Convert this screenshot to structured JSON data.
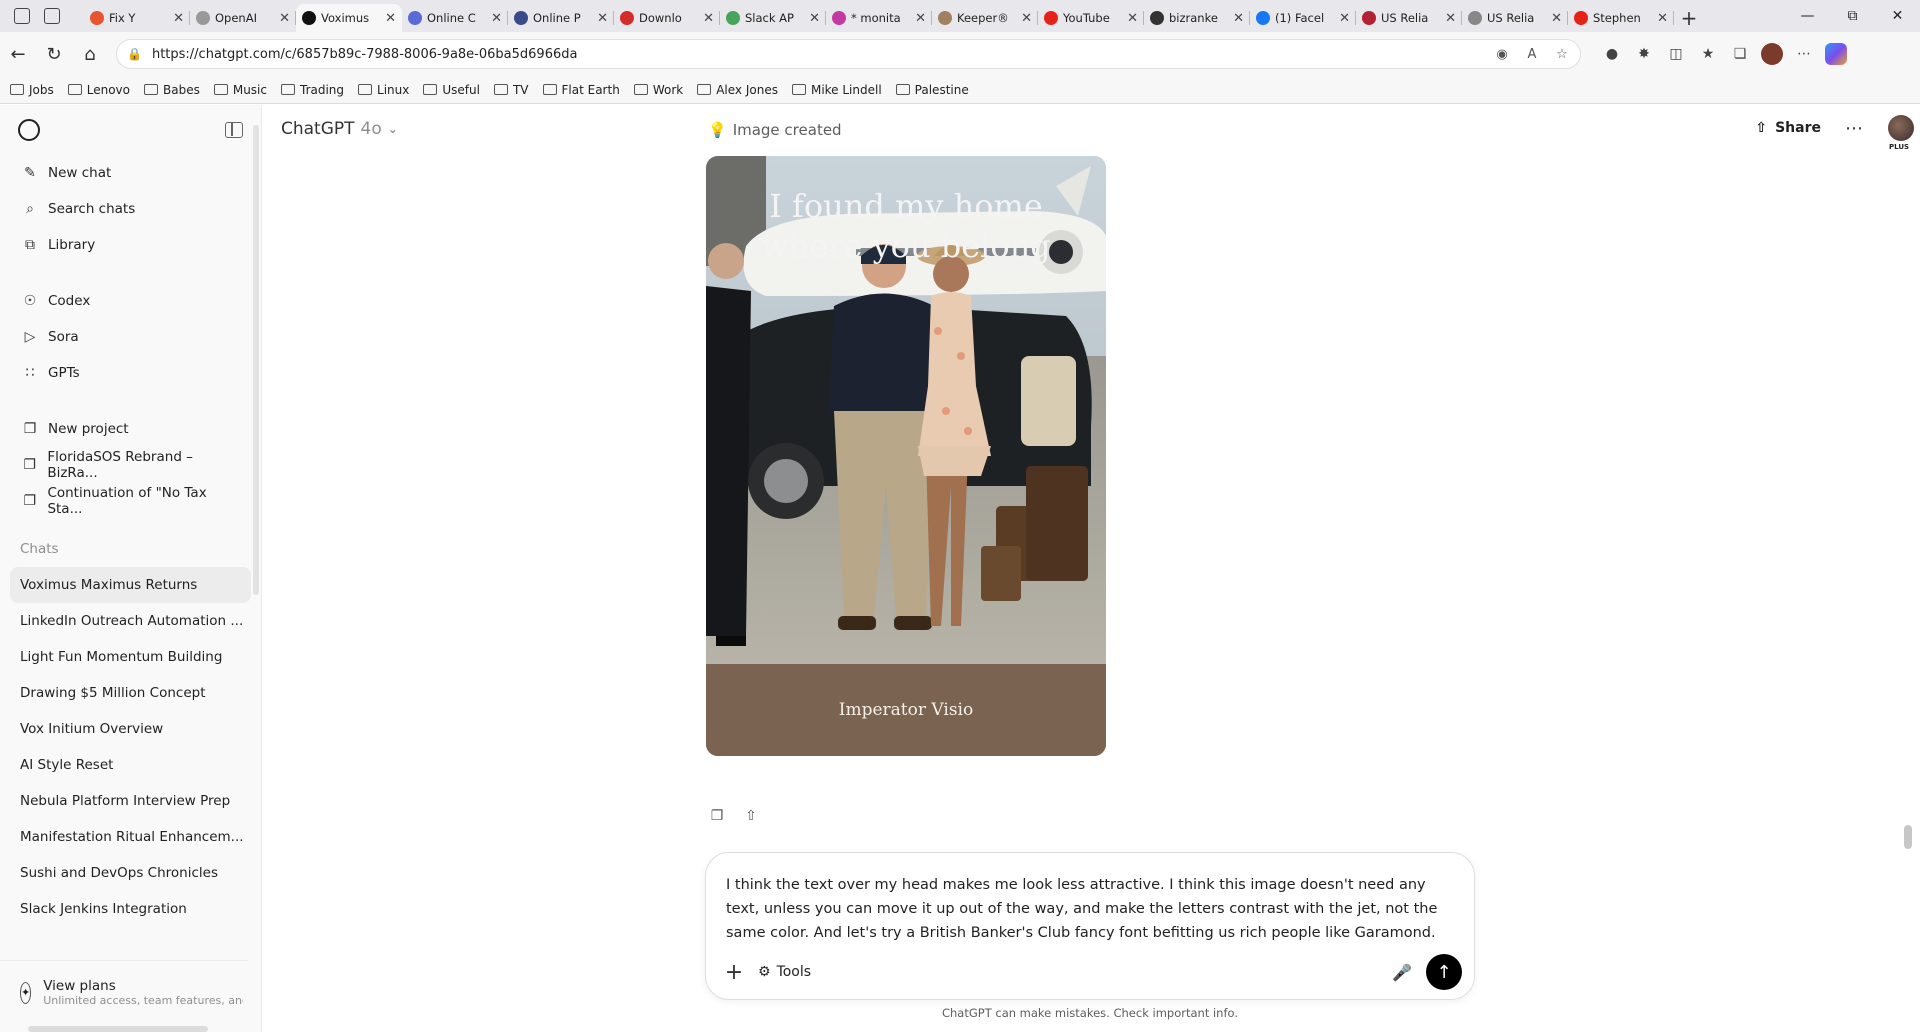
{
  "browser": {
    "tabs": [
      {
        "label": "Fix Y",
        "color": "#e8542f"
      },
      {
        "label": "OpenAI",
        "color": "#999999"
      },
      {
        "label": "Voximus",
        "color": "#111111",
        "active": true
      },
      {
        "label": "Online C",
        "color": "#5a6bd8"
      },
      {
        "label": "Online P",
        "color": "#3a4a8a"
      },
      {
        "label": "Downlo",
        "color": "#d42b2b"
      },
      {
        "label": "Slack AP",
        "color": "#4aa35a"
      },
      {
        "label": "* monita",
        "color": "#c23aa0"
      },
      {
        "label": "Keeper®",
        "color": "#a08060"
      },
      {
        "label": "YouTube",
        "color": "#e62117"
      },
      {
        "label": "bizranke",
        "color": "#333333"
      },
      {
        "label": "(1) Facel",
        "color": "#1877f2"
      },
      {
        "label": "US Relia",
        "color": "#b22234"
      },
      {
        "label": "US Relia",
        "color": "#888888"
      },
      {
        "label": "Stephen",
        "color": "#e62117"
      }
    ],
    "url": "https://chatgpt.com/c/6857b89c-7988-8006-9a8e-06ba5d6966da",
    "bookmarks": [
      "Jobs",
      "Lenovo",
      "Babes",
      "Music",
      "Trading",
      "Linux",
      "Useful",
      "TV",
      "Flat Earth",
      "Work",
      "Alex Jones",
      "Mike Lindell",
      "Palestine"
    ]
  },
  "sidebar": {
    "nav": [
      {
        "label": "New chat",
        "icon": "edit-icon"
      },
      {
        "label": "Search chats",
        "icon": "search-icon"
      },
      {
        "label": "Library",
        "icon": "library-icon"
      }
    ],
    "apps": [
      {
        "label": "Codex",
        "icon": "codex-icon"
      },
      {
        "label": "Sora",
        "icon": "sora-icon"
      },
      {
        "label": "GPTs",
        "icon": "gpts-icon"
      }
    ],
    "projects": [
      {
        "label": "New project",
        "icon": "new-folder-icon"
      },
      {
        "label": "FloridaSOS Rebrand – BizRa...",
        "icon": "folder-icon"
      },
      {
        "label": "Continuation of \"No Tax Sta...",
        "icon": "folder-icon"
      }
    ],
    "chats_heading": "Chats",
    "chats": [
      "Voximus Maximus Returns",
      "LinkedIn Outreach Automation ...",
      "Light Fun Momentum Building",
      "Drawing $5 Million Concept",
      "Vox Initium Overview",
      "AI Style Reset",
      "Nebula Platform Interview Prep",
      "Manifestation Ritual Enhancem...",
      "Sushi and DevOps Chronicles",
      "Slack Jenkins Integration"
    ],
    "plans_title": "View plans",
    "plans_sub": "Unlimited access, team features, and"
  },
  "header": {
    "model_name": "ChatGPT",
    "model_version": "4o",
    "share_label": "Share",
    "plan_badge": "PLUS"
  },
  "message": {
    "status": "Image created",
    "image_title_line1": "I found my home",
    "image_title_line2": "where you belong",
    "image_footer": "Imperator Visio"
  },
  "composer": {
    "text": "I think the text over my head makes me look less attractive. I think this image doesn't need any text, unless you can move it up out of the way, and make the letters contrast with the jet, not the same color. And let's try a British Banker's Club fancy font befitting us rich people like Garamond.",
    "tools_label": "Tools"
  },
  "disclaimer": "ChatGPT can make mistakes. Check important info."
}
